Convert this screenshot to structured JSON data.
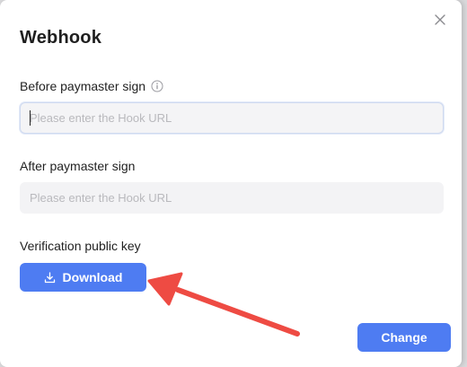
{
  "dialog": {
    "title": "Webhook"
  },
  "before_sign": {
    "label": "Before paymaster sign",
    "placeholder": "Please enter the Hook URL",
    "value": ""
  },
  "after_sign": {
    "label": "After paymaster sign",
    "placeholder": "Please enter the Hook URL",
    "value": ""
  },
  "public_key": {
    "label": "Verification public key",
    "download_label": "Download"
  },
  "footer": {
    "change_label": "Change"
  },
  "icons": {
    "close": "close-icon",
    "info": "info-icon",
    "download": "download-icon"
  },
  "colors": {
    "primary": "#4e7cf2",
    "annotation_arrow": "#ee4b43"
  }
}
